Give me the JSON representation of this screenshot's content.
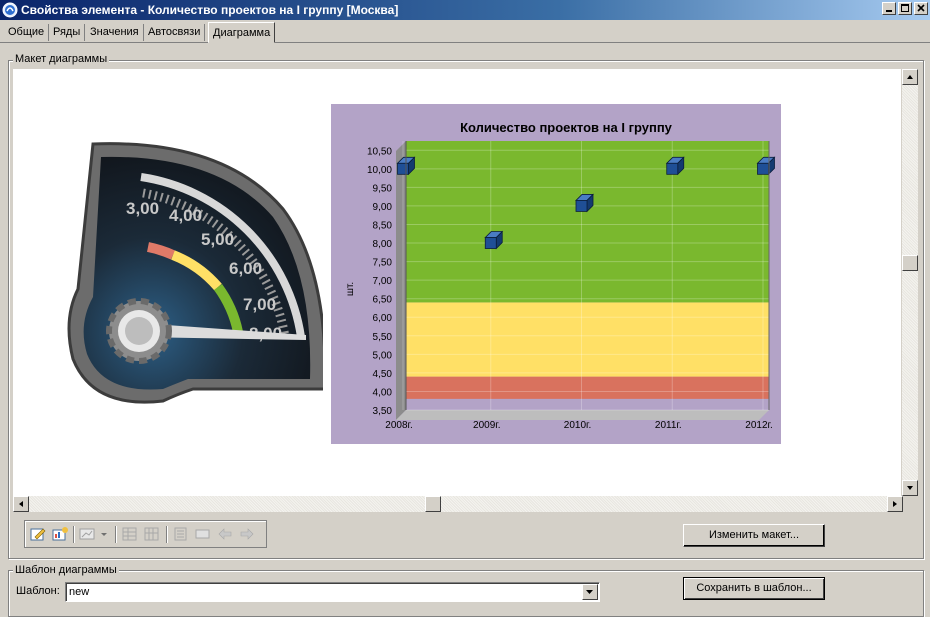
{
  "window": {
    "title": "Свойства элемента - Количество проектов на I группу [Москва]"
  },
  "tabs": [
    {
      "label": "Общие"
    },
    {
      "label": "Ряды"
    },
    {
      "label": "Значения"
    },
    {
      "label": "Автосвязи"
    },
    {
      "label": "Диаграмма",
      "active": true
    }
  ],
  "layout_group": {
    "label": "Макет диаграммы"
  },
  "gauge": {
    "tick_labels": [
      "3,00",
      "4,00",
      "5,00",
      "6,00",
      "7,00",
      "8,00"
    ],
    "value": 8.0,
    "colors": {
      "red": "#e07a68",
      "yellow": "#ffe066",
      "green": "#7ab82e"
    }
  },
  "chart_data": {
    "type": "scatter",
    "title": "Количество проектов на I группу",
    "ylabel": "шт.",
    "xlabel": "",
    "categories": [
      "2008г.",
      "2009г.",
      "2010г.",
      "2011г.",
      "2012г."
    ],
    "values": [
      10.0,
      8.0,
      9.0,
      10.0,
      10.0
    ],
    "ylim": [
      3.5,
      10.75
    ],
    "yticks": [
      "3,50",
      "4,00",
      "4,50",
      "5,00",
      "5,50",
      "6,00",
      "6,50",
      "7,00",
      "7,50",
      "8,00",
      "8,50",
      "9,00",
      "9,50",
      "10,00",
      "10,50"
    ],
    "bands": [
      {
        "from": 3.8,
        "to": 4.4,
        "color": "#d9725e"
      },
      {
        "from": 4.4,
        "to": 6.4,
        "color": "#ffe066"
      },
      {
        "from": 6.4,
        "to": 10.75,
        "color": "#7ab82e"
      }
    ],
    "background": "#b3a3c7",
    "marker_color": "#1f4f96",
    "grid": true
  },
  "buttons": {
    "change_layout": "Изменить макет...",
    "save_template": "Сохранить в шаблон..."
  },
  "template_group": {
    "label": "Шаблон диаграммы",
    "field_label": "Шаблон:",
    "value": "new"
  }
}
